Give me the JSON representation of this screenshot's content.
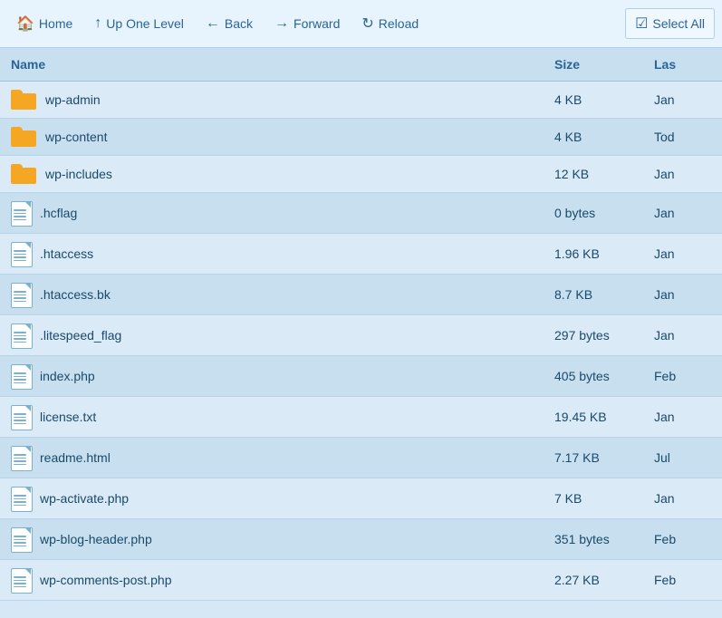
{
  "toolbar": {
    "home_label": "Home",
    "up_label": "Up One Level",
    "back_label": "Back",
    "forward_label": "Forward",
    "reload_label": "Reload",
    "select_all_label": "Select All"
  },
  "table": {
    "col_name": "Name",
    "col_size": "Size",
    "col_last": "Las"
  },
  "files": [
    {
      "name": "wp-admin",
      "type": "folder",
      "size": "4 KB",
      "date": "Jan"
    },
    {
      "name": "wp-content",
      "type": "folder",
      "size": "4 KB",
      "date": "Tod"
    },
    {
      "name": "wp-includes",
      "type": "folder",
      "size": "12 KB",
      "date": "Jan"
    },
    {
      "name": ".hcflag",
      "type": "file",
      "size": "0 bytes",
      "date": "Jan"
    },
    {
      "name": ".htaccess",
      "type": "file",
      "size": "1.96 KB",
      "date": "Jan"
    },
    {
      "name": ".htaccess.bk",
      "type": "file",
      "size": "8.7 KB",
      "date": "Jan"
    },
    {
      "name": ".litespeed_flag",
      "type": "file",
      "size": "297 bytes",
      "date": "Jan"
    },
    {
      "name": "index.php",
      "type": "file",
      "size": "405 bytes",
      "date": "Feb"
    },
    {
      "name": "license.txt",
      "type": "file",
      "size": "19.45 KB",
      "date": "Jan"
    },
    {
      "name": "readme.html",
      "type": "file-html",
      "size": "7.17 KB",
      "date": "Jul"
    },
    {
      "name": "wp-activate.php",
      "type": "file",
      "size": "7 KB",
      "date": "Jan"
    },
    {
      "name": "wp-blog-header.php",
      "type": "file",
      "size": "351 bytes",
      "date": "Feb"
    },
    {
      "name": "wp-comments-post.php",
      "type": "file",
      "size": "2.27 KB",
      "date": "Feb"
    }
  ]
}
